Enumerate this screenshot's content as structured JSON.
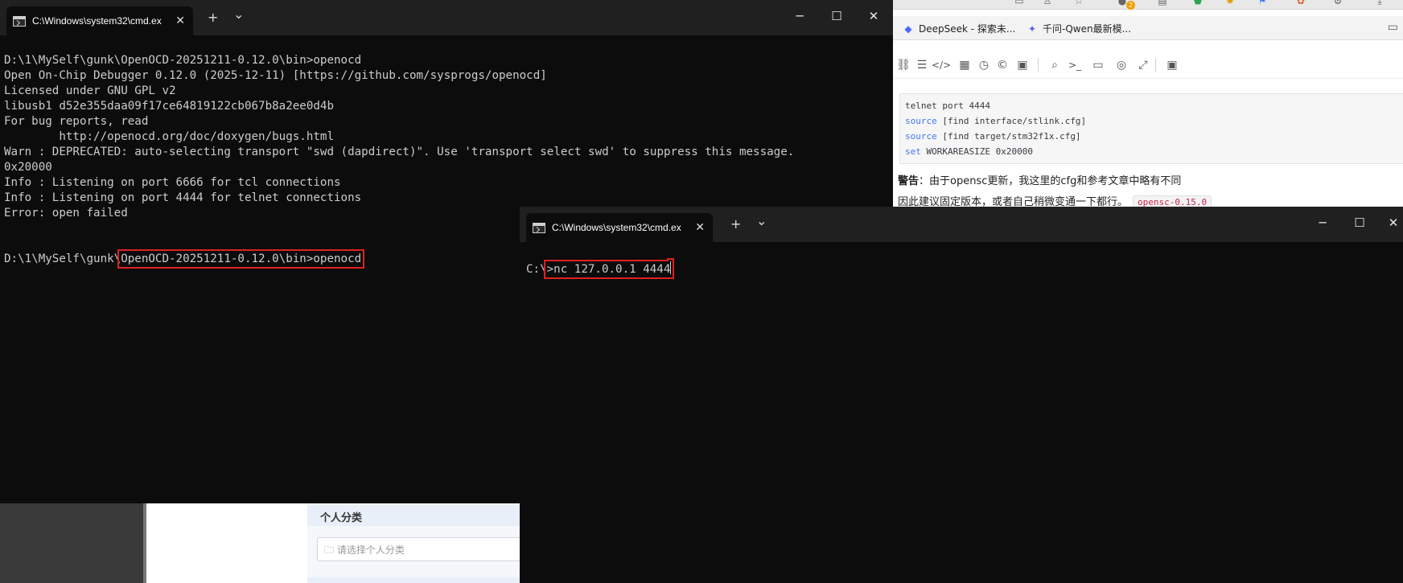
{
  "browser": {
    "badge_count": "2",
    "bookmarks": [
      {
        "label": "DeepSeek - 探索未...",
        "icon": "deepseek-whale-icon"
      },
      {
        "label": "千问-Qwen最新模...",
        "icon": "qwen-logo-icon"
      }
    ],
    "toolbar_icons": [
      "link-icon",
      "outline-icon",
      "code-icon",
      "table-icon",
      "clock-icon",
      "copyright-icon",
      "template-icon",
      "search-icon",
      "terminal-prompt-icon",
      "monitor-icon",
      "eye-off-icon",
      "fullscreen-icon",
      "save-icon"
    ],
    "code_lines": [
      {
        "kw": "",
        "rest": "telnet port 4444"
      },
      {
        "kw": "source",
        "rest": " [find interface/stlink.cfg]"
      },
      {
        "kw": "source",
        "rest": " [find target/stm32f1x.cfg]"
      },
      {
        "kw": "set",
        "rest": " WORKAREASIZE 0x20000"
      }
    ],
    "warning_label": "警告",
    "warning_text": "：由于opensc更新，我这里的cfg和参考文章中略有不同",
    "warning_line2": "因此建议固定版本，或者自己稍微变通一下都行。",
    "inline_code": "opensc-0.15.0"
  },
  "page_panel": {
    "header": "个人分类",
    "select_placeholder": "请选择个人分类"
  },
  "terminal1": {
    "tab_title": "C:\\Windows\\system32\\cmd.ex",
    "new_tab": "+",
    "dropdown": "⌄",
    "lines": [
      "D:\\1\\MySelf\\gunk\\OpenOCD-20251211-0.12.0\\bin>openocd",
      "Open On-Chip Debugger 0.12.0 (2025-12-11) [https://github.com/sysprogs/openocd]",
      "Licensed under GNU GPL v2",
      "libusb1 d52e355daa09f17ce64819122cb067b8a2ee0d4b",
      "For bug reports, read",
      "        http://openocd.org/doc/doxygen/bugs.html",
      "Warn : DEPRECATED: auto-selecting transport \"swd (dapdirect)\". Use 'transport select swd' to suppress this message.",
      "0x20000",
      "Info : Listening on port 6666 for tcl connections",
      "Info : Listening on port 4444 for telnet connections",
      "Error: open failed",
      "",
      ""
    ],
    "prompt_prefix": "D:\\1\\MySelf\\gunk\\",
    "prompt_highlighted": "OpenOCD-20251211-0.12.0\\bin>openocd"
  },
  "terminal2": {
    "tab_title": "C:\\Windows\\system32\\cmd.ex",
    "new_tab": "+",
    "dropdown": "⌄",
    "prompt_prefix": "C:\\",
    "prompt_highlighted": ">nc 127.0.0.1 4444"
  },
  "colors": {
    "terminal_bg": "#0c0c0c",
    "titlebar_bg": "#202020",
    "terminal_text": "#cccccc",
    "highlight_box": "#e02020"
  }
}
